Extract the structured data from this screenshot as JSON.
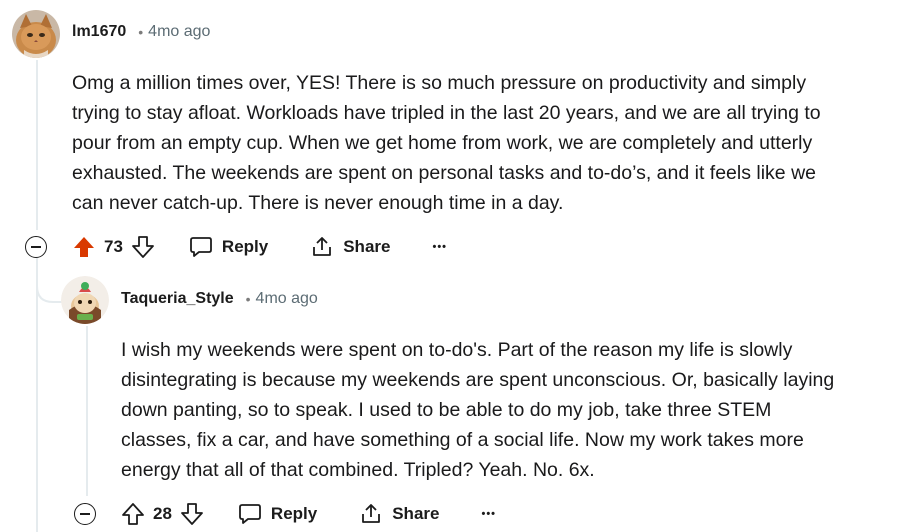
{
  "comments": [
    {
      "username": "lm1670",
      "dot": "•",
      "age": "4mo ago",
      "body_lines": [
        "Omg a million times over, YES! There is so much pressure on productivity and simply",
        "trying to stay afloat. Workloads have tripled in the last 20 years, and we are all trying to",
        "pour from an empty cup. When we get home from work, we are completely and utterly",
        "exhausted. The weekends are spent on personal tasks and to-do’s, and it feels like we",
        "can never catch-up. There is never enough time in a day."
      ],
      "score": "73",
      "upvoted": true,
      "reply_label": "Reply",
      "share_label": "Share",
      "more_label": "•••"
    },
    {
      "username": "Taqueria_Style",
      "dot": "•",
      "age": "4mo ago",
      "body_lines": [
        "I wish my weekends were spent on to-do's. Part of the reason my life is slowly",
        "disintegrating is because my weekends are spent unconscious. Or, basically laying",
        "down panting, so to speak. I used to be able to do my job, take three STEM",
        "classes, fix a car, and have something of a social life. Now my work takes more",
        "energy that all of that combined. Tripled? Yeah. No. 6x."
      ],
      "score": "28",
      "upvoted": false,
      "reply_label": "Reply",
      "share_label": "Share",
      "more_label": "•••"
    }
  ],
  "colors": {
    "upvote_active": "#d93900",
    "text": "#1a1a1b",
    "meta": "#5c6c74",
    "thread_line": "#e5ebee"
  },
  "icons": {
    "upvote": "arrow-up-icon",
    "downvote": "arrow-down-icon",
    "reply": "speech-bubble-icon",
    "share": "share-icon",
    "collapse": "minus-circle-icon"
  }
}
